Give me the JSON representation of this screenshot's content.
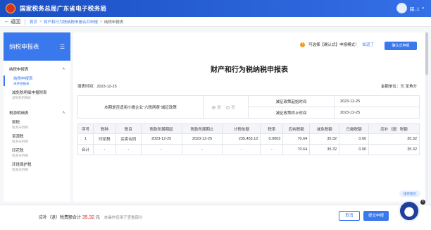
{
  "topbar": {
    "title": "国家税务总局广东省电子税务局",
    "user": "韶..1"
  },
  "breadcrumb": {
    "back": "返回",
    "items": [
      "首页",
      "财产和行为税纳税申报合并申报",
      "纳税申报表"
    ]
  },
  "sidebar": {
    "title": "纳税申报表",
    "groups": [
      {
        "label": "纳税申报表",
        "items": [
          {
            "label": "纳税申报表",
            "sub": "未开始报表"
          },
          {
            "label": "减免税明细申报附表",
            "sub": "减免税明细表"
          }
        ]
      },
      {
        "label": "税源明细表",
        "items": [
          {
            "label": "契税",
            "sub": "税源未明细"
          },
          {
            "label": "资源税",
            "sub": "税源未明细"
          },
          {
            "label": "印花税",
            "sub": "税源未明细"
          },
          {
            "label": "环境保护税",
            "sub": "税源未明细"
          }
        ]
      }
    ]
  },
  "notice": {
    "text": "可选择【确认式】申报模式！",
    "link": "知道了",
    "button": "确认式申报"
  },
  "report": {
    "title": "财产和行为税纳税申报表",
    "period_label": "填表时间：2023-12-25",
    "unit_label": "金额单位：元 至角分",
    "policy": {
      "question": "本期是否适用小微企业“六税两费”减征政策",
      "yes": "是",
      "no": "否",
      "start_label": "减征政策起始时间",
      "start_value": "2023-12-25",
      "end_label": "减征政策终止时间",
      "end_value": "2023-12-25"
    },
    "columns": [
      "序号",
      "税种",
      "税目",
      "税款所属期起",
      "税款所属期止",
      "计税依据",
      "税率",
      "应纳税额",
      "减免税额",
      "已缴税额",
      "应补（退）税额"
    ],
    "rows": [
      [
        "1",
        "印花税",
        "买卖合同",
        "2023-12-25",
        "2023-12-25",
        "235,455.12",
        "0.0003",
        "70.64",
        "35.32",
        "0.00",
        "35.32"
      ],
      [
        "合计",
        "-",
        "-",
        "-",
        "-",
        "-",
        "-",
        "70.64",
        "35.32",
        "0.00",
        "35.32"
      ]
    ]
  },
  "footer": {
    "sum_label": "应补（退）税费额合计",
    "sum_value": "35.32",
    "sum_unit": "元",
    "hint": "本操作仅用于查看部分",
    "cancel": "取消",
    "submit": "提交申报",
    "side_pill": "操作指引"
  }
}
